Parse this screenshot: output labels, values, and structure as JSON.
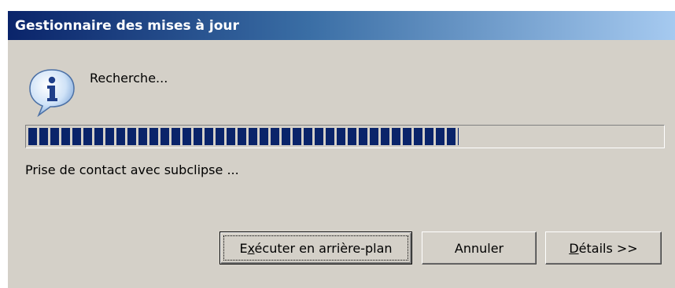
{
  "window": {
    "title": "Gestionnaire des mises à jour"
  },
  "status": {
    "heading": "Recherche...",
    "detail": "Prise de contact avec subclipse ...",
    "progress_fraction": 0.68,
    "icon": "information-icon"
  },
  "buttons": {
    "run_background": {
      "pre": "E",
      "mnemonic": "x",
      "post": "écuter en arrière-plan"
    },
    "cancel": {
      "label": "Annuler"
    },
    "details": {
      "mnemonic": "D",
      "post": "étails >>"
    }
  },
  "colors": {
    "titlebar_start": "#0a246a",
    "titlebar_end": "#a6caf0",
    "progress_block": "#0a246a",
    "dialog_background": "#d4d0c8"
  }
}
